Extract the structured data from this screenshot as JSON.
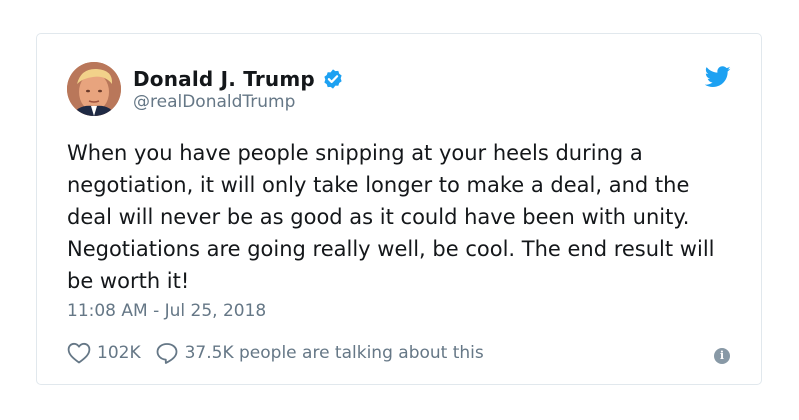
{
  "author": {
    "display_name": "Donald J. Trump",
    "handle": "@realDonaldTrump",
    "verified": true
  },
  "tweet": {
    "text": "When you have people snipping at your heels during a negotiation, it will only take longer to make a deal, and the deal will never be as good as it could have been with unity. Negotiations are going really well, be cool. The end result will be worth it!",
    "timestamp": "11:08 AM - Jul 25, 2018"
  },
  "actions": {
    "likes": "102K",
    "talking": "37.5K people are talking about this"
  },
  "icons": {
    "brand": "twitter-bird-icon",
    "verified": "verified-badge-icon",
    "like": "heart-icon",
    "reply": "speech-bubble-icon",
    "info": "info-icon"
  },
  "colors": {
    "brand_blue": "#1da1f2",
    "secondary_text": "#657786",
    "border": "#e1e8ed"
  }
}
